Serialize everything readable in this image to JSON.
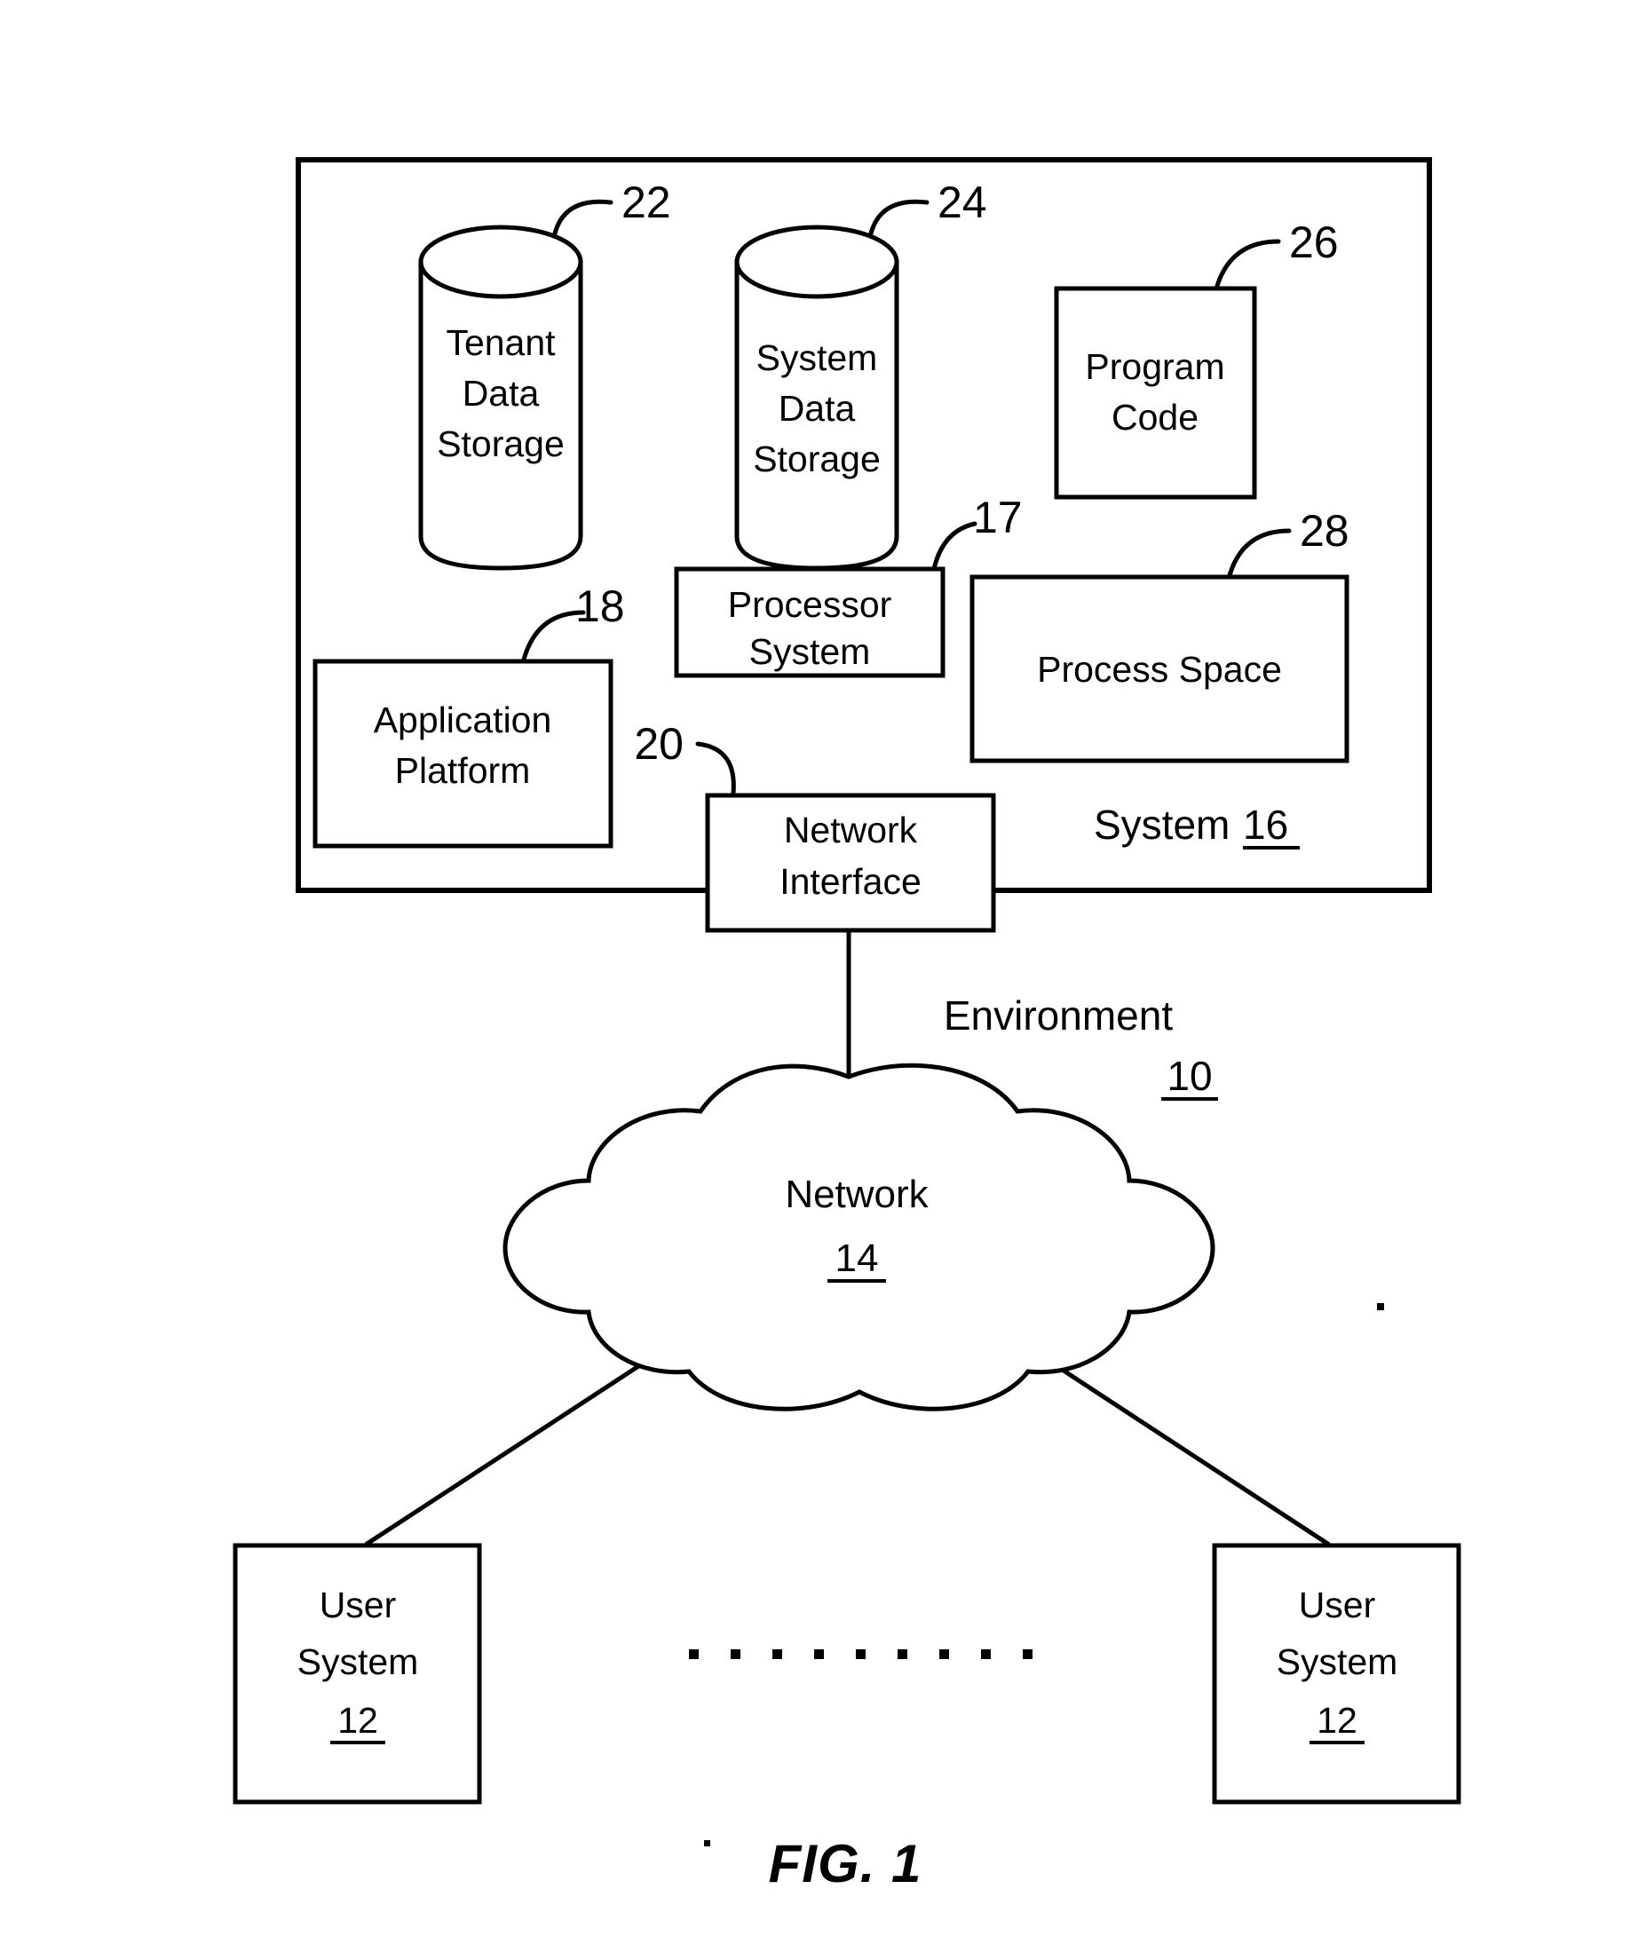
{
  "figure": {
    "caption": "FIG. 1",
    "environment_label": "Environment",
    "environment_ref": "10",
    "system_label": "System",
    "system_ref": "16"
  },
  "system_box": {
    "ref": "16",
    "components": [
      {
        "id": "tenant-data-storage",
        "shape": "cylinder",
        "ref": "22",
        "lines": [
          "Tenant",
          "Data",
          "Storage"
        ]
      },
      {
        "id": "system-data-storage",
        "shape": "cylinder",
        "ref": "24",
        "lines": [
          "System",
          "Data",
          "Storage"
        ]
      },
      {
        "id": "program-code",
        "shape": "rect",
        "ref": "26",
        "lines": [
          "Program",
          "Code"
        ]
      },
      {
        "id": "processor-system",
        "shape": "rect",
        "ref": "17",
        "lines": [
          "Processor",
          "System"
        ]
      },
      {
        "id": "process-space",
        "shape": "rect",
        "ref": "28",
        "lines": [
          "Process Space"
        ]
      },
      {
        "id": "application-platform",
        "shape": "rect",
        "ref": "18",
        "lines": [
          "Application",
          "Platform"
        ]
      },
      {
        "id": "network-interface",
        "shape": "rect",
        "ref": "20",
        "lines": [
          "Network",
          "Interface"
        ]
      }
    ]
  },
  "network": {
    "id": "network-cloud",
    "shape": "cloud",
    "label": "Network",
    "ref": "14"
  },
  "user_systems": [
    {
      "id": "user-system-left",
      "lines": [
        "User",
        "System"
      ],
      "ref": "12"
    },
    {
      "id": "user-system-right",
      "lines": [
        "User",
        "System"
      ],
      "ref": "12"
    }
  ],
  "ellipsis": {
    "id": "user-systems-ellipsis",
    "dot_count": 9,
    "symbol": "· · · · · · · · ·"
  },
  "colors": {
    "stroke": "#000000",
    "fill": "#ffffff"
  }
}
